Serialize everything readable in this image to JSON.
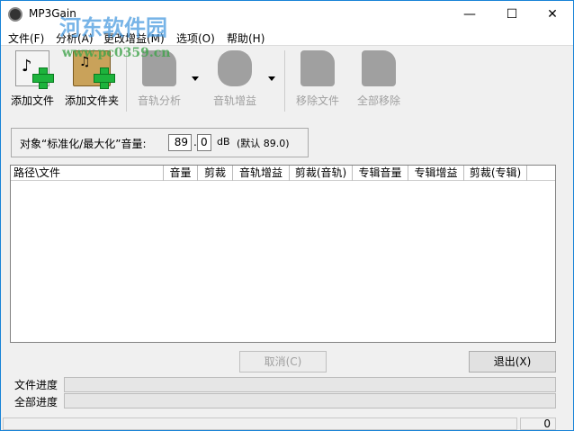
{
  "window": {
    "title": "MP3Gain",
    "minimize": "—",
    "maximize": "☐",
    "close": "✕"
  },
  "watermark": {
    "name": "河东软件园",
    "url": "www.pc0359.cn"
  },
  "menu": [
    "文件(F)",
    "分析(A)",
    "更改增益(M)",
    "选项(O)",
    "帮助(H)"
  ],
  "toolbar": {
    "add_file": "添加文件",
    "add_folder": "添加文件夹",
    "track_analysis": "音轨分析",
    "track_gain": "音轨增益",
    "remove_file": "移除文件",
    "remove_all": "全部移除"
  },
  "target": {
    "label": "对象“标准化/最大化”音量:",
    "int": "89",
    "dot": ".",
    "dec": "0",
    "unit": "dB",
    "default": "(默认 89.0)"
  },
  "columns": [
    "路径\\文件",
    "音量",
    "剪裁",
    "音轨增益",
    "剪裁(音轨)",
    "专辑音量",
    "专辑增益",
    "剪裁(专辑)"
  ],
  "buttons": {
    "cancel": "取消(C)",
    "exit": "退出(X)"
  },
  "progress": {
    "file_label": "文件进度",
    "all_label": "全部进度",
    "file": 0,
    "all": 0
  },
  "status": {
    "count": "0"
  }
}
